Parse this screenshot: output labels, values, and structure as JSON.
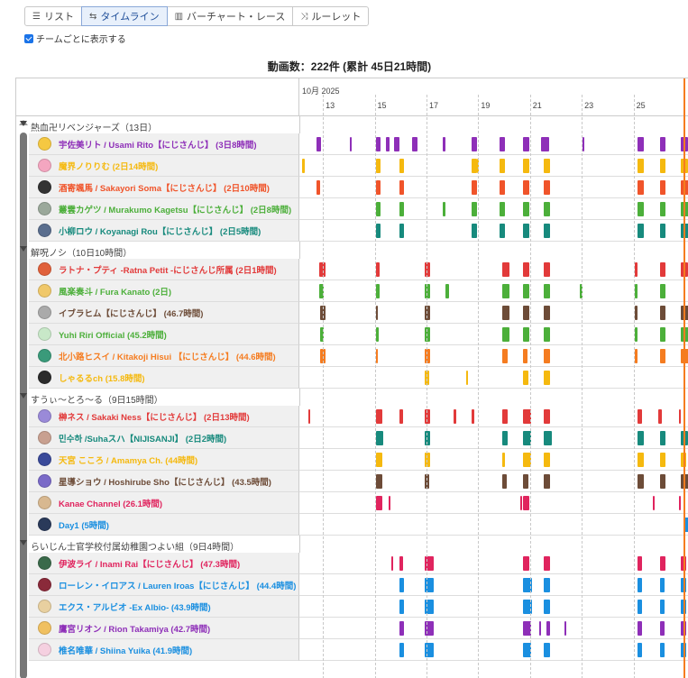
{
  "tabs": [
    {
      "icon": "list-icon",
      "glyph": "☰",
      "label": "リスト",
      "active": false
    },
    {
      "icon": "timeline-icon",
      "glyph": "⇆",
      "label": "タイムライン",
      "active": true
    },
    {
      "icon": "bar-chart-icon",
      "glyph": "▥",
      "label": "バーチャート・レース",
      "active": false
    },
    {
      "icon": "shuffle-icon",
      "glyph": "⤨",
      "label": "ルーレット",
      "active": false
    }
  ],
  "checkbox_label": "チームごとに表示する",
  "summary": "動画数：222件 (累計 45日21時間)",
  "axis": {
    "month": "10月 2025",
    "ticks": [
      "13",
      "15",
      "17",
      "19",
      "21",
      "23",
      "25"
    ],
    "start_day": 11.95,
    "end_day": 27.0
  },
  "colors": {
    "purple": "#8e2fb8",
    "yellow": "#f5b90f",
    "red": "#f0542a",
    "green": "#4caf3a",
    "teal": "#178a7d",
    "crimson": "#e23a3a",
    "brown": "#6d4c38",
    "orange": "#f57c20",
    "blue": "#1a8fe0",
    "pink": "#e0245e",
    "darkgreen": "#4a9a3d"
  },
  "groups": [
    {
      "title": "熱血卍リベンジャーズ（13日）",
      "members": [
        {
          "name": "宇佐美リト / Usami Rito【にじさんじ】 (3日8時間)",
          "color": "#8e2fb8",
          "avatar": "#f5c842",
          "events": [
            [
              12.6,
              0.2
            ],
            [
              13.9,
              0.08
            ],
            [
              14.9,
              0.2
            ],
            [
              15.3,
              0.12
            ],
            [
              15.6,
              0.2
            ],
            [
              16.3,
              0.2
            ],
            [
              17.5,
              0.1
            ],
            [
              18.6,
              0.2
            ],
            [
              19.7,
              0.2
            ],
            [
              20.6,
              0.25
            ],
            [
              21.3,
              0.3
            ],
            [
              22.9,
              0.06
            ],
            [
              25.0,
              0.25
            ],
            [
              25.9,
              0.2
            ],
            [
              26.7,
              0.25
            ]
          ]
        },
        {
          "name": "魔界ノりりむ (2日14時間)",
          "color": "#f5b90f",
          "avatar": "#f4a6c0",
          "events": [
            [
              12.05,
              0.1
            ],
            [
              14.9,
              0.2
            ],
            [
              15.8,
              0.2
            ],
            [
              18.6,
              0.2
            ],
            [
              18.8,
              0.1
            ],
            [
              19.7,
              0.2
            ],
            [
              20.6,
              0.25
            ],
            [
              21.4,
              0.25
            ],
            [
              25.0,
              0.25
            ],
            [
              25.9,
              0.2
            ],
            [
              26.7,
              0.25
            ]
          ]
        },
        {
          "name": "酒寄颯馬 / Sakayori Soma【にじさんじ】 (2日10時間)",
          "color": "#f0542a",
          "avatar": "#333333",
          "events": [
            [
              12.6,
              0.15
            ],
            [
              14.9,
              0.2
            ],
            [
              15.8,
              0.2
            ],
            [
              18.6,
              0.2
            ],
            [
              19.7,
              0.2
            ],
            [
              20.6,
              0.25
            ],
            [
              21.4,
              0.25
            ],
            [
              25.0,
              0.25
            ],
            [
              25.9,
              0.2
            ],
            [
              26.7,
              0.3
            ]
          ]
        },
        {
          "name": "叢雲カゲツ / Murakumo Kagetsu【にじさんじ】 (2日8時間)",
          "color": "#4caf3a",
          "avatar": "#9aa89a",
          "events": [
            [
              14.9,
              0.2
            ],
            [
              15.8,
              0.2
            ],
            [
              17.5,
              0.1
            ],
            [
              18.6,
              0.2
            ],
            [
              19.7,
              0.2
            ],
            [
              20.6,
              0.25
            ],
            [
              21.4,
              0.25
            ],
            [
              25.0,
              0.25
            ],
            [
              25.9,
              0.2
            ],
            [
              26.7,
              0.3
            ]
          ]
        },
        {
          "name": "小柳ロウ / Koyanagi Rou【にじさんじ】 (2日5時間)",
          "color": "#178a7d",
          "avatar": "#5a6e8e",
          "events": [
            [
              14.9,
              0.2
            ],
            [
              15.8,
              0.2
            ],
            [
              18.6,
              0.2
            ],
            [
              19.7,
              0.2
            ],
            [
              20.6,
              0.25
            ],
            [
              21.4,
              0.25
            ],
            [
              25.0,
              0.25
            ],
            [
              25.9,
              0.2
            ],
            [
              26.7,
              0.3
            ]
          ]
        }
      ]
    },
    {
      "title": "解呪ノシ（10日10時間）",
      "members": [
        {
          "name": "ラトナ・プティ -Ratna Petit -にじさんじ所属 (2日1時間)",
          "color": "#e23a3a",
          "avatar": "#e0603a",
          "events": [
            [
              12.7,
              0.25
            ],
            [
              14.9,
              0.15
            ],
            [
              16.8,
              0.2
            ],
            [
              19.8,
              0.25
            ],
            [
              20.6,
              0.25
            ],
            [
              21.4,
              0.25
            ],
            [
              24.9,
              0.1
            ],
            [
              25.9,
              0.2
            ],
            [
              26.7,
              0.25
            ]
          ]
        },
        {
          "name": "風楽奏斗 / Fura Kanato (2日)",
          "color": "#4caf3a",
          "avatar": "#f0c86a",
          "events": [
            [
              12.7,
              0.2
            ],
            [
              14.9,
              0.15
            ],
            [
              16.8,
              0.2
            ],
            [
              17.6,
              0.15
            ],
            [
              19.8,
              0.25
            ],
            [
              20.6,
              0.25
            ],
            [
              21.4,
              0.25
            ],
            [
              22.8,
              0.1
            ],
            [
              24.9,
              0.1
            ],
            [
              25.9,
              0.2
            ]
          ]
        },
        {
          "name": "イブラヒム【にじさんじ】 (46.7時間)",
          "color": "#6d4c38",
          "avatar": "#aaaaaa",
          "events": [
            [
              12.75,
              0.2
            ],
            [
              14.9,
              0.06
            ],
            [
              16.8,
              0.2
            ],
            [
              19.8,
              0.25
            ],
            [
              20.6,
              0.25
            ],
            [
              21.4,
              0.25
            ],
            [
              24.9,
              0.1
            ],
            [
              25.9,
              0.2
            ],
            [
              26.7,
              0.3
            ]
          ]
        },
        {
          "name": "Yuhi Riri Official (45.2時間)",
          "color": "#4caf3a",
          "avatar": "#c8e8c8",
          "events": [
            [
              12.75,
              0.15
            ],
            [
              14.9,
              0.1
            ],
            [
              16.8,
              0.2
            ],
            [
              19.8,
              0.25
            ],
            [
              20.6,
              0.25
            ],
            [
              21.4,
              0.25
            ],
            [
              24.9,
              0.1
            ],
            [
              25.9,
              0.2
            ],
            [
              26.7,
              0.35
            ]
          ]
        },
        {
          "name": "北小路ヒスイ / Kitakoji Hisui 【にじさんじ】 (44.6時間)",
          "color": "#f57c20",
          "avatar": "#3a9a7a",
          "events": [
            [
              12.75,
              0.2
            ],
            [
              14.9,
              0.06
            ],
            [
              16.8,
              0.2
            ],
            [
              19.8,
              0.2
            ],
            [
              20.6,
              0.15
            ],
            [
              21.4,
              0.25
            ],
            [
              24.9,
              0.1
            ],
            [
              25.9,
              0.2
            ],
            [
              26.7,
              0.3
            ]
          ]
        },
        {
          "name": "しゃるるch (15.8時間)",
          "color": "#f5b90f",
          "avatar": "#2b2b2b",
          "events": [
            [
              16.8,
              0.15
            ],
            [
              18.4,
              0.08
            ],
            [
              20.6,
              0.2
            ],
            [
              21.4,
              0.25
            ]
          ]
        }
      ]
    },
    {
      "title": "すうぃ〜とろ〜る（9日15時間）",
      "members": [
        {
          "name": "榊ネス / Sakaki Ness【にじさんじ】 (2日13時間)",
          "color": "#e23a3a",
          "avatar": "#9a8ad8",
          "events": [
            [
              12.3,
              0.08
            ],
            [
              14.9,
              0.25
            ],
            [
              15.8,
              0.15
            ],
            [
              16.8,
              0.2
            ],
            [
              17.9,
              0.1
            ],
            [
              18.6,
              0.1
            ],
            [
              19.8,
              0.2
            ],
            [
              20.6,
              0.3
            ],
            [
              21.4,
              0.25
            ],
            [
              25.0,
              0.2
            ],
            [
              25.8,
              0.15
            ],
            [
              26.6,
              0.1
            ]
          ]
        },
        {
          "name": "민수하 /Suhaスハ【NIJISANJI】 (2日2時間)",
          "color": "#178a7d",
          "avatar": "#c8a090",
          "events": [
            [
              14.9,
              0.3
            ],
            [
              16.8,
              0.2
            ],
            [
              19.8,
              0.2
            ],
            [
              20.6,
              0.3
            ],
            [
              21.4,
              0.3
            ],
            [
              25.0,
              0.25
            ],
            [
              25.9,
              0.2
            ],
            [
              26.7,
              0.25
            ]
          ]
        },
        {
          "name": "天宮 こころ / Amamya Ch. (44時間)",
          "color": "#f5b90f",
          "avatar": "#3a4a9a",
          "events": [
            [
              14.9,
              0.25
            ],
            [
              16.8,
              0.2
            ],
            [
              19.8,
              0.1
            ],
            [
              20.6,
              0.3
            ],
            [
              21.4,
              0.25
            ],
            [
              25.0,
              0.25
            ],
            [
              25.9,
              0.2
            ],
            [
              26.7,
              0.2
            ]
          ]
        },
        {
          "name": "星導ショウ / Hoshirube Sho【にじさんじ】 (43.5時間)",
          "color": "#6d4c38",
          "avatar": "#7a6ac8",
          "events": [
            [
              14.9,
              0.25
            ],
            [
              16.8,
              0.15
            ],
            [
              19.8,
              0.15
            ],
            [
              20.6,
              0.2
            ],
            [
              21.4,
              0.25
            ],
            [
              25.0,
              0.25
            ],
            [
              25.9,
              0.2
            ],
            [
              26.7,
              0.3
            ]
          ]
        },
        {
          "name": "Kanae Channel (26.1時間)",
          "color": "#e0245e",
          "avatar": "#d8b890",
          "events": [
            [
              14.9,
              0.25
            ],
            [
              15.4,
              0.06
            ],
            [
              20.5,
              0.06
            ],
            [
              20.6,
              0.25
            ],
            [
              25.6,
              0.06
            ],
            [
              26.6,
              0.06
            ]
          ]
        },
        {
          "name": "Day1 (5時間)",
          "color": "#1a8fe0",
          "avatar": "#2a3a5a",
          "events": [
            [
              26.8,
              0.3
            ]
          ]
        }
      ]
    },
    {
      "title": "らいじん士官学校付属幼稚園つよい組（9日4時間）",
      "members": [
        {
          "name": "伊波ライ / Inami Rai【にじさんじ】 (47.3時間)",
          "color": "#e0245e",
          "avatar": "#3a6a4a",
          "events": [
            [
              15.5,
              0.08
            ],
            [
              15.8,
              0.15
            ],
            [
              16.8,
              0.35
            ],
            [
              20.6,
              0.25
            ],
            [
              21.4,
              0.25
            ],
            [
              25.0,
              0.2
            ],
            [
              25.9,
              0.2
            ],
            [
              26.7,
              0.2
            ]
          ]
        },
        {
          "name": "ローレン・イロアス / Lauren Iroas【にじさんじ】 (44.4時間)",
          "color": "#1a8fe0",
          "avatar": "#8a2a3a",
          "events": [
            [
              15.8,
              0.2
            ],
            [
              16.8,
              0.35
            ],
            [
              20.6,
              0.35
            ],
            [
              21.4,
              0.25
            ],
            [
              25.0,
              0.2
            ],
            [
              25.9,
              0.15
            ],
            [
              26.7,
              0.2
            ]
          ]
        },
        {
          "name": "エクス・アルビオ -Ex Albio- (43.9時間)",
          "color": "#1a8fe0",
          "avatar": "#e8d0a0",
          "events": [
            [
              15.8,
              0.2
            ],
            [
              16.8,
              0.35
            ],
            [
              20.6,
              0.35
            ],
            [
              21.4,
              0.25
            ],
            [
              25.0,
              0.2
            ],
            [
              25.9,
              0.15
            ],
            [
              26.7,
              0.2
            ]
          ]
        },
        {
          "name": "鷹宮リオン / Rion Takamiya (42.7時間)",
          "color": "#8e2fb8",
          "avatar": "#f0c060",
          "events": [
            [
              15.8,
              0.2
            ],
            [
              16.8,
              0.35
            ],
            [
              20.6,
              0.3
            ],
            [
              21.2,
              0.1
            ],
            [
              21.5,
              0.15
            ],
            [
              22.2,
              0.06
            ],
            [
              25.0,
              0.2
            ],
            [
              25.9,
              0.15
            ],
            [
              26.7,
              0.2
            ]
          ]
        },
        {
          "name": "椎名唯華 / Shiina Yuika (41.9時間)",
          "color": "#1a8fe0",
          "avatar": "#f5d0e0",
          "events": [
            [
              15.8,
              0.2
            ],
            [
              16.8,
              0.35
            ],
            [
              20.6,
              0.3
            ],
            [
              21.4,
              0.25
            ],
            [
              25.0,
              0.2
            ],
            [
              25.9,
              0.15
            ],
            [
              26.7,
              0.2
            ]
          ]
        }
      ]
    }
  ]
}
